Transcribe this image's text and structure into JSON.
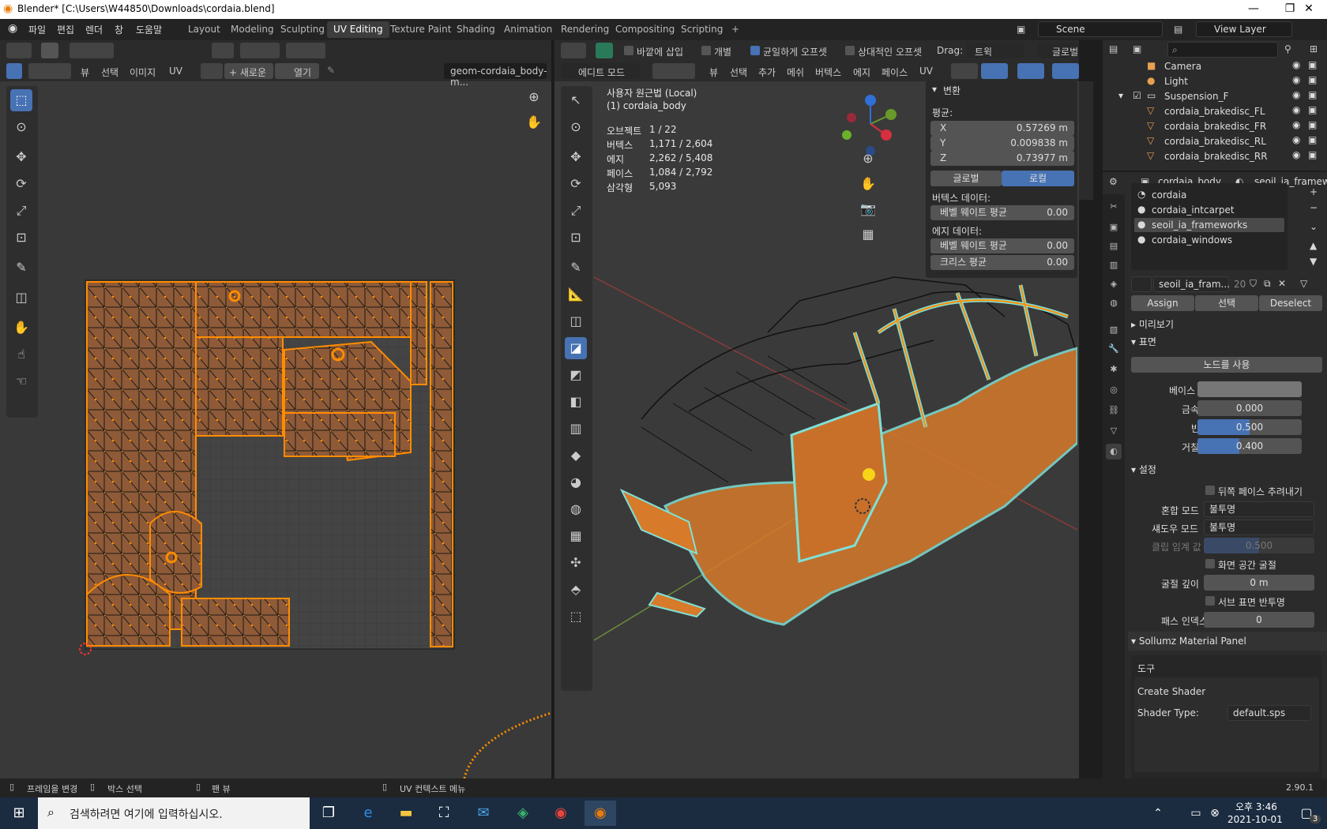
{
  "window": {
    "title": "Blender* [C:\\Users\\W44850\\Downloads\\cordaia.blend]",
    "min": "—",
    "max": "❐",
    "close": "✕"
  },
  "menu": [
    "파일",
    "편집",
    "렌더",
    "창",
    "도움말"
  ],
  "workspaces": [
    "Layout",
    "Modeling",
    "Sculpting",
    "UV Editing",
    "Texture Paint",
    "Shading",
    "Animation",
    "Rendering",
    "Compositing",
    "Scripting"
  ],
  "workspace_add": "+",
  "scene": "Scene",
  "view_layer": "View Layer",
  "uv_editor": {
    "header_menus": [
      "뷰",
      "선택",
      "이미지",
      "UV"
    ],
    "new_button": "+ 새로운",
    "open_button": "열기",
    "image_name": "geom-cordaia_body-m..."
  },
  "viewport": {
    "toolbar_opts": [
      "바깥에 삽입",
      "개별",
      "균일하게 오프셋",
      "상대적인 오프셋"
    ],
    "toolbar_checked": [
      false,
      false,
      true,
      false
    ],
    "drag_label": "Drag:",
    "drag_value": "트윅",
    "orientation": "글로벌",
    "mode": "에디트 모드",
    "header_menus": [
      "뷰",
      "선택",
      "추가",
      "메쉬",
      "버텍스",
      "에지",
      "페이스",
      "UV"
    ],
    "view_title": "사용자 원근법 (Local)",
    "object_name": "(1) cordaia_body",
    "stats": [
      {
        "label": "오브젝트",
        "value": "1 / 22"
      },
      {
        "label": "버텍스",
        "value": "1,171 / 2,604"
      },
      {
        "label": "에지",
        "value": "2,262 / 5,408"
      },
      {
        "label": "페이스",
        "value": "1,084 / 2,792"
      },
      {
        "label": "삼각형",
        "value": "5,093"
      }
    ],
    "transform": {
      "title": "변환",
      "median": "평균:",
      "x_label": "X",
      "x": "0.57269 m",
      "y_label": "Y",
      "y": "0.009838 m",
      "z_label": "Z",
      "z": "0.73977 m",
      "global": "글로벌",
      "local": "로컬",
      "vertex_data": "버텍스 데이터:",
      "vertex_bevel": "베벨 웨이트 평균",
      "vertex_bevel_val": "0.00",
      "edge_data": "에지 데이터:",
      "edge_bevel": "베벨 웨이트 평균",
      "edge_bevel_val": "0.00",
      "crease": "크리스 평균",
      "crease_val": "0.00"
    }
  },
  "outliner": {
    "search_placeholder": "",
    "items": [
      {
        "name": "Camera"
      },
      {
        "name": "Light"
      },
      {
        "name": "Suspension_F"
      },
      {
        "name": "cordaia_brakedisc_FL"
      },
      {
        "name": "cordaia_brakedisc_FR"
      },
      {
        "name": "cordaia_brakedisc_RL"
      },
      {
        "name": "cordaia_brakedisc_RR"
      }
    ]
  },
  "properties": {
    "object": "cordaia_body",
    "material_tab": "seoil_ia_framewor",
    "slots": [
      "cordaia",
      "cordaia_intcarpet",
      "seoil_ia_frameworks",
      "cordaia_windows"
    ],
    "material_name": "seoil_ia_fram...",
    "users": "20",
    "assign": "Assign",
    "select": "선택",
    "deselect": "Deselect",
    "preview": "미리보기",
    "surface": "표면",
    "use_nodes": "노드를 사용",
    "base_color": "베이스 컬러",
    "metallic": "금속성",
    "metallic_val": "0.000",
    "specular": "반사",
    "specular_val": "0.500",
    "specular_frac": 0.5,
    "roughness": "거칠기",
    "roughness_val": "0.400",
    "roughness_frac": 0.4,
    "settings": "설정",
    "backface": "뒤쪽 페이스 추려내기",
    "blend_mode": "혼합 모드",
    "blend_val": "불투명",
    "shadow_mode": "섀도우 모드",
    "shadow_val": "불투명",
    "clip": "클립 임계 값",
    "clip_val": "0.500",
    "ss_refraction": "화면 공간 굴절",
    "refr_depth": "굴절 깊이",
    "refr_val": "0 m",
    "sss": "서브 표면 반투명",
    "pass_index": "패스 인덱스",
    "pass_val": "0",
    "sollumz": "Sollumz Material Panel",
    "tools": "도구",
    "create_shader": "Create Shader",
    "shader_type": "Shader Type:",
    "shader_val": "default.sps"
  },
  "status": {
    "items": [
      "프레임을 변경",
      "박스 선택",
      "팬 뷰",
      "UV 컨텍스트 메뉴"
    ],
    "version": "2.90.1"
  },
  "taskbar": {
    "search": "검색하려면 여기에 입력하십시오.",
    "time": "오후 3:46",
    "date": "2021-10-01",
    "notif": "3"
  }
}
